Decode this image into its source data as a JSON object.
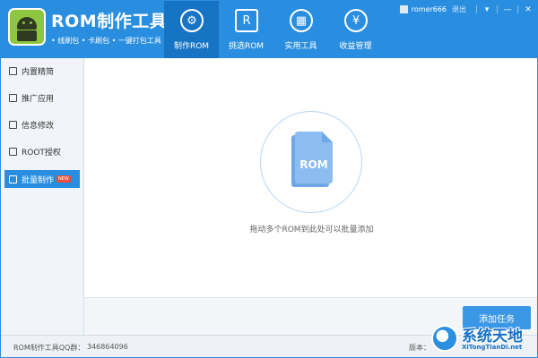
{
  "header": {
    "app_title": "ROM制作工具",
    "app_subtitle": "• 线刷包  • 卡刷包  • 一键打包工具",
    "nav": [
      {
        "label": "制作ROM",
        "icon": "gear-icon",
        "glyph": "⚙",
        "active": true
      },
      {
        "label": "挑选ROM",
        "icon": "store-icon",
        "glyph": "R",
        "active": false
      },
      {
        "label": "实用工具",
        "icon": "grid-icon",
        "glyph": "▦",
        "active": false
      },
      {
        "label": "收益管理",
        "icon": "heart-yen-icon",
        "glyph": "¥",
        "active": false
      }
    ],
    "user": {
      "name": "romer666",
      "logout": "退出",
      "controls": [
        "▾",
        "—",
        "✕"
      ]
    }
  },
  "sidebar": {
    "items": [
      {
        "label": "内置精简",
        "icon": "box-icon",
        "active": false
      },
      {
        "label": "推广应用",
        "icon": "export-icon",
        "active": false
      },
      {
        "label": "信息修改",
        "icon": "document-icon",
        "active": false
      },
      {
        "label": "ROOT授权",
        "icon": "lock-icon",
        "active": false
      },
      {
        "label": "批量制作",
        "icon": "batch-icon",
        "active": true,
        "badge": "NEW"
      }
    ]
  },
  "main": {
    "file_icon_text": "ROM",
    "drop_hint": "拖动多个ROM到此处可以批量添加",
    "add_task": "添加任务"
  },
  "statusbar": {
    "qq_label": "ROM制作工具QQ群：",
    "qq_number": "346864096",
    "version_label": "版本："
  },
  "watermark": {
    "cn": "系统天地",
    "en": "XiTongTianDi.net"
  },
  "colors": {
    "primary": "#2a8ee0",
    "active_nav": "#1773c4",
    "badge": "#f04b3a"
  }
}
